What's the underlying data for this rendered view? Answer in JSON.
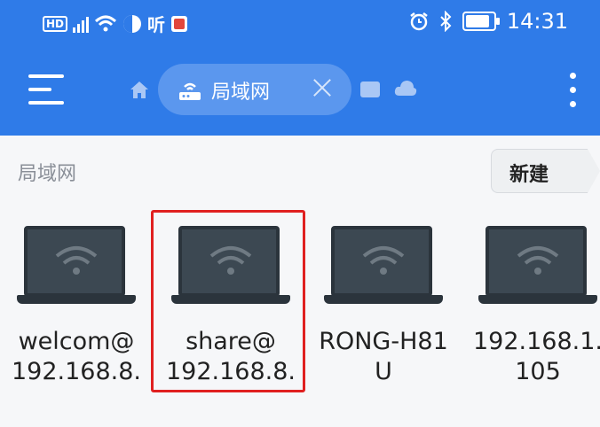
{
  "status_bar": {
    "left_icons": [
      "hd-icon",
      "signal-icon",
      "wifi-icon",
      "shield-icon",
      "ting-icon",
      "notification-icon"
    ],
    "right_icons": [
      "alarm-icon",
      "bluetooth-icon",
      "battery-icon"
    ],
    "hd_label": "HD",
    "ting_label": "听",
    "time": "14:31"
  },
  "toolbar": {
    "menu_icon": "hamburger-icon",
    "home_icon": "home-icon",
    "active_tab": {
      "label": "局域网",
      "icon": "router-icon"
    },
    "extra_icons": [
      "box-icon",
      "cloud-icon"
    ],
    "more_icon": "more-vertical-icon"
  },
  "breadcrumb": "局域网",
  "new_button": "新建",
  "devices": [
    {
      "name": "welcom@\n192.168.8.",
      "icon": "laptop-wifi-icon"
    },
    {
      "name": "share@\n192.168.8.",
      "icon": "laptop-wifi-icon",
      "highlighted": true
    },
    {
      "name": "RONG-H81\nU",
      "icon": "laptop-wifi-icon"
    },
    {
      "name": "192.168.1.\n105",
      "icon": "laptop-wifi-icon"
    }
  ],
  "colors": {
    "appbar": "#2f7be8",
    "tab": "#5b97ee",
    "highlight": "#e02020"
  }
}
